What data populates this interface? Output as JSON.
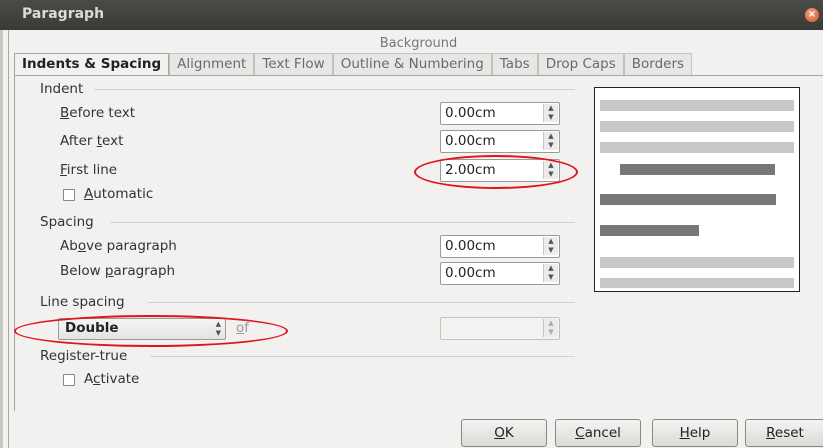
{
  "window": {
    "title": "Paragraph"
  },
  "tabs": {
    "row1": [
      "Background"
    ],
    "row2": [
      "Indents & Spacing",
      "Alignment",
      "Text Flow",
      "Outline & Numbering",
      "Tabs",
      "Drop Caps",
      "Borders"
    ],
    "active": "Indents & Spacing"
  },
  "indent": {
    "section_label": "Indent",
    "before_text": {
      "label_prefix": "",
      "label_ul": "B",
      "label_rest": "efore text",
      "value": "0.00cm"
    },
    "after_text": {
      "label_prefix": "After ",
      "label_ul": "t",
      "label_rest": "ext",
      "value": "0.00cm"
    },
    "first_line": {
      "label_prefix": "",
      "label_ul": "F",
      "label_rest": "irst line",
      "value": "2.00cm"
    },
    "automatic": {
      "label_prefix": "",
      "label_ul": "A",
      "label_rest": "utomatic",
      "checked": false
    }
  },
  "spacing": {
    "section_label": "Spacing",
    "above": {
      "label_prefix": "Ab",
      "label_ul": "o",
      "label_rest": "ve paragraph",
      "value": "0.00cm"
    },
    "below": {
      "label_prefix": "Below ",
      "label_ul": "p",
      "label_rest": "aragraph",
      "value": "0.00cm"
    }
  },
  "line_spacing": {
    "section_label": "Line spacing",
    "selected": "Double",
    "of_label_ul": "o",
    "of_label_rest": "f",
    "of_value": ""
  },
  "register_true": {
    "section_label": "Register-true",
    "activate": {
      "label_prefix": "A",
      "label_ul": "c",
      "label_rest": "tivate",
      "checked": false
    }
  },
  "buttons": {
    "ok": {
      "ul": "O",
      "rest": "K"
    },
    "cancel": {
      "ul": "C",
      "rest": "ancel"
    },
    "help": {
      "ul": "H",
      "rest": "elp"
    },
    "reset": {
      "ul": "R",
      "rest": "eset"
    }
  },
  "annotation_color": "#e0141a"
}
